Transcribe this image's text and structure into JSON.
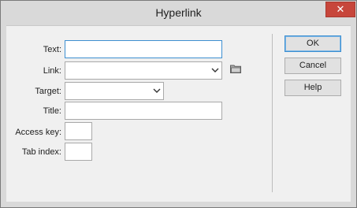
{
  "window": {
    "title": "Hyperlink",
    "close_glyph": "✕"
  },
  "form": {
    "text_label": "Text:",
    "text_value": "",
    "link_label": "Link:",
    "link_value": "",
    "target_label": "Target:",
    "target_value": "",
    "title_label": "Title:",
    "title_value": "",
    "access_key_label": "Access key:",
    "access_key_value": "",
    "tab_index_label": "Tab index:",
    "tab_index_value": ""
  },
  "buttons": {
    "ok": "OK",
    "cancel": "Cancel",
    "help": "Help"
  },
  "icons": {
    "browse": "folder-icon",
    "close": "close-icon",
    "dropdown": "chevron-down-icon"
  },
  "colors": {
    "focus_border": "#3d8fd1",
    "close_button": "#c7463b"
  }
}
